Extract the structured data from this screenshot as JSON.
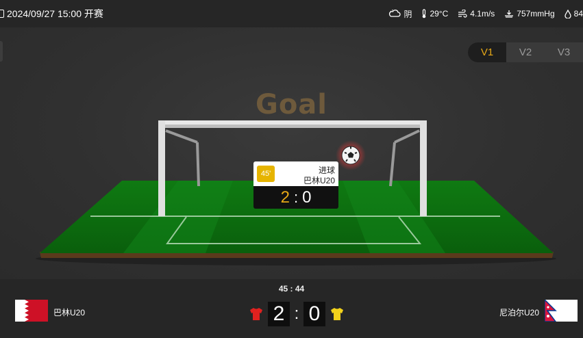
{
  "header": {
    "datetime": "2024/09/27 15:00 开赛",
    "weather": {
      "condition": "阴",
      "temperature": "29°C",
      "wind": "4.1m/s",
      "pressure": "757mmHg",
      "humidity": "84"
    }
  },
  "views": {
    "tabs": [
      "V1",
      "V2",
      "V3"
    ],
    "active": "V1"
  },
  "animation": {
    "title": "Goal",
    "event": {
      "minute": "45'",
      "type": "进球",
      "team": "巴林U20",
      "home_score": "2",
      "away_score": "0",
      "separator": ":"
    }
  },
  "match": {
    "time": "45 : 44",
    "home_team": "巴林U20",
    "away_team": "尼泊尔U20",
    "home_score": "2",
    "away_score": "0",
    "separator": ":",
    "home_shirt_color": "#e0211f",
    "away_shirt_color": "#f2d21b"
  },
  "icons": {
    "calendar": "calendar-icon",
    "weather": "cloudy-icon",
    "temperature": "thermometer-icon",
    "wind": "wind-icon",
    "pressure": "pressure-icon",
    "humidity": "humidity-icon",
    "ball": "soccer-ball-icon"
  },
  "colors": {
    "accent": "#e6a817",
    "pitch": "#1a8a1a",
    "background": "#2f2f2f"
  }
}
